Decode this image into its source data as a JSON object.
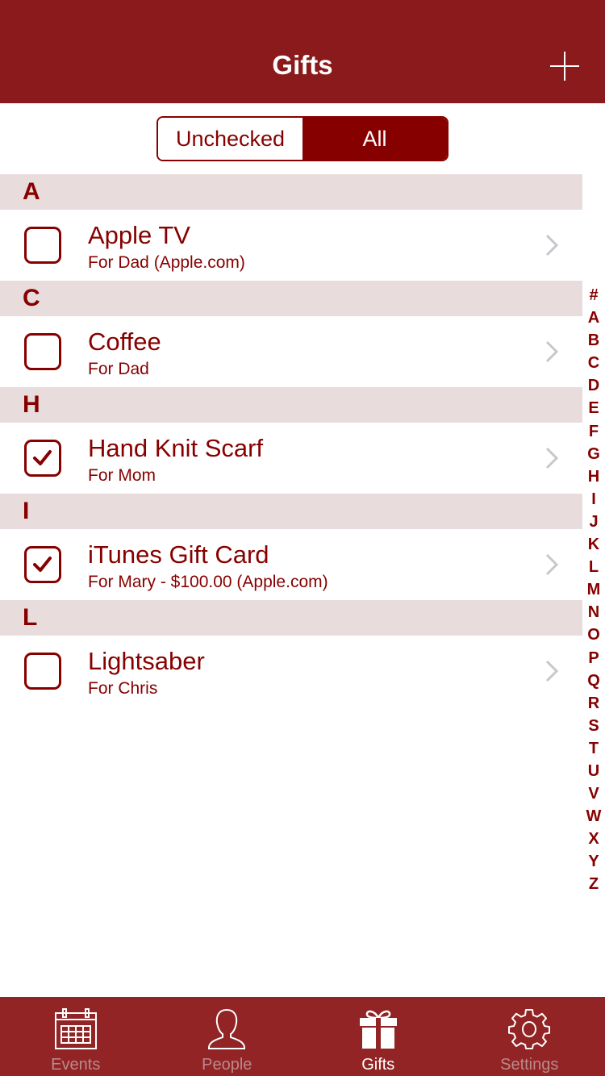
{
  "navbar": {
    "title": "Gifts",
    "add_icon": "plus-icon"
  },
  "filter": {
    "options": [
      "Unchecked",
      "All"
    ],
    "selected": "All"
  },
  "sections": [
    {
      "letter": "A",
      "items": [
        {
          "title": "Apple TV",
          "subtitle": "For Dad (Apple.com)",
          "checked": false
        }
      ]
    },
    {
      "letter": "C",
      "items": [
        {
          "title": "Coffee",
          "subtitle": "For Dad",
          "checked": false
        }
      ]
    },
    {
      "letter": "H",
      "items": [
        {
          "title": "Hand Knit Scarf",
          "subtitle": "For Mom",
          "checked": true
        }
      ]
    },
    {
      "letter": "I",
      "items": [
        {
          "title": "iTunes Gift Card",
          "subtitle": "For Mary - $100.00 (Apple.com)",
          "checked": true
        }
      ]
    },
    {
      "letter": "L",
      "items": [
        {
          "title": "Lightsaber",
          "subtitle": "For Chris",
          "checked": false
        }
      ]
    }
  ],
  "index": [
    "#",
    "A",
    "B",
    "C",
    "D",
    "E",
    "F",
    "G",
    "H",
    "I",
    "J",
    "K",
    "L",
    "M",
    "N",
    "O",
    "P",
    "Q",
    "R",
    "S",
    "T",
    "U",
    "V",
    "W",
    "X",
    "Y",
    "Z"
  ],
  "tabs": [
    {
      "label": "Events",
      "icon": "calendar-icon",
      "active": false
    },
    {
      "label": "People",
      "icon": "person-icon",
      "active": false
    },
    {
      "label": "Gifts",
      "icon": "gift-icon",
      "active": true
    },
    {
      "label": "Settings",
      "icon": "gear-icon",
      "active": false
    }
  ],
  "colors": {
    "navbar": "#8a1a1b",
    "accent": "#870000",
    "section_bg": "#e8dcdd",
    "tabbar": "#932426",
    "chevron": "#c7c7cc"
  }
}
